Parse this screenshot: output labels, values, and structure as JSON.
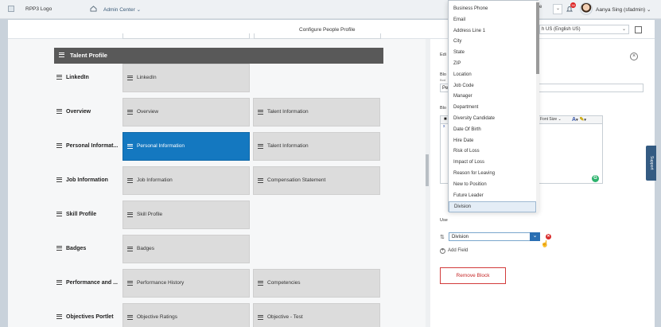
{
  "shell": {
    "logo": "RPP3 Logo",
    "admin_center": "Admin Center",
    "selector_fragment": "e",
    "notification_count": "38",
    "user": "Aanya Sing (sfadmin)"
  },
  "subbar": {
    "title": "Configure People Profile",
    "locale": "h US (English US)"
  },
  "talent_profile": {
    "header": "Talent Profile",
    "rows": [
      {
        "label": "LinkedIn",
        "cards": [
          "LinkedIn"
        ]
      },
      {
        "label": "Overview",
        "cards": [
          "Overview",
          "Talent Information"
        ]
      },
      {
        "label": "Personal Informat...",
        "cards": [
          "Personal Information",
          "Talent Information"
        ]
      },
      {
        "label": "Job Information",
        "cards": [
          "Job Information",
          "Compensation Statement"
        ]
      },
      {
        "label": "Skill Profile",
        "cards": [
          "Skill Profile"
        ]
      },
      {
        "label": "Badges",
        "cards": [
          "Badges"
        ]
      },
      {
        "label": "Performance and ...",
        "cards": [
          "Performance History",
          "Competencies"
        ]
      },
      {
        "label": "Objectives Portlet",
        "cards": [
          "Objective Ratings",
          "Objective - Test"
        ]
      }
    ]
  },
  "panel": {
    "edit_label": "Edi",
    "block_label": "Blo",
    "block_sub": "Bod",
    "input_value": "Pe",
    "block_label2": "Blo",
    "font_size": "Font Size",
    "use_label": "Use",
    "selected_field": "Division",
    "add_field": "Add Field",
    "remove_block": "Remove Block",
    "close": "×"
  },
  "dropdown": {
    "options": [
      "Business Phone",
      "Email",
      "Address Line 1",
      "City",
      "State",
      "ZIP",
      "Location",
      "Job Code",
      "Manager",
      "Department",
      "Diversity Candidate",
      "Date Of Birth",
      "Hire Date",
      "Risk of Loss",
      "Impact of Loss",
      "Reason for Leaving",
      "New to Position",
      "Future Leader",
      "Division"
    ],
    "highlighted": "Division"
  },
  "support": "Support",
  "colors": {
    "selected_card": "#1478c0",
    "header": "#595959",
    "remove": "#d23b3b"
  }
}
